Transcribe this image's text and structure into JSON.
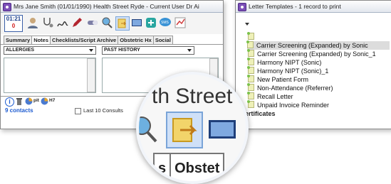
{
  "left_window": {
    "title": "Mrs Jane Smith (01/01/1990) Health Street Ryde - Current User Dr Ai",
    "clock": {
      "time": "01:21",
      "count": "0"
    },
    "toolbar_icons": [
      "user-icon",
      "stethoscope-icon",
      "signature-icon",
      "pen-icon",
      "pill-icon",
      "search-user-icon",
      "letter-templates-icon",
      "monitor-icon",
      "add-icon",
      "sms-icon",
      "chart-icon"
    ],
    "tabs": [
      "Summary",
      "Notes",
      "Checklists/Script Archive",
      "Obstetric Hx",
      "Social"
    ],
    "active_tab": "Notes",
    "allergies_label": "ALLERGIES",
    "past_history_label": "PAST HISTORY",
    "icon_labels": {
      "pit": "pit",
      "h7": "H7"
    },
    "contacts_label": "9 contacts",
    "last_consults_label": "Last 10 Consults"
  },
  "right_window": {
    "title": "Letter Templates - 1 record to print",
    "items": [
      "Carrier Screening (Expanded) by Sonic",
      "Carrier Screening (Expanded) by Sonic_1",
      "Harmony NIPT (Sonic)",
      "Harmony NIPT (Sonic)_1",
      "New Patient Form",
      "Non-Attendance (Referrer)",
      "Recall Letter",
      "Unpaid Invoice Reminder"
    ],
    "selected_index": 0,
    "section_label": "ertificates"
  },
  "magnifier": {
    "text": "th Street Ry",
    "tab_partial_1": "s",
    "tab_partial_2": "Obstet"
  },
  "colors": {
    "accent": "#7b4fb6",
    "link_blue": "#1d5bd0",
    "badge_red": "#d01818"
  }
}
